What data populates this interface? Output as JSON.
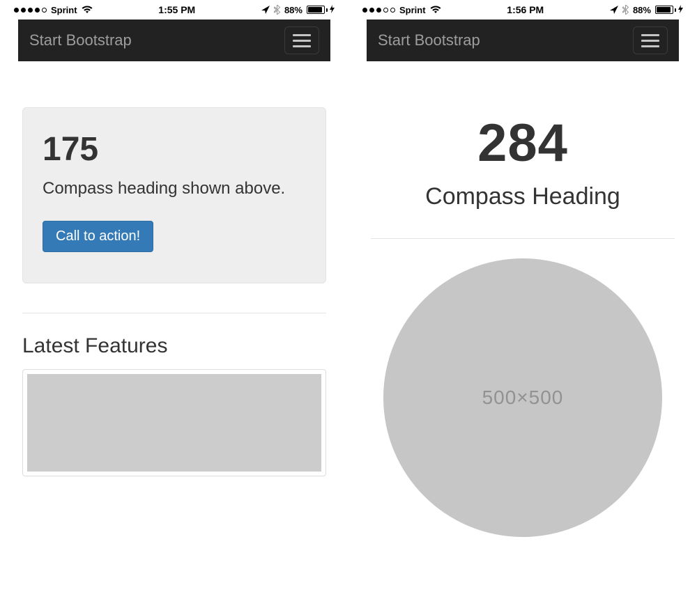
{
  "left": {
    "status": {
      "carrier": "Sprint",
      "signal_filled": 4,
      "signal_total": 5,
      "time": "1:55 PM",
      "battery_pct": "88%"
    },
    "navbar": {
      "brand": "Start Bootstrap"
    },
    "well": {
      "heading_value": "175",
      "description": "Compass heading shown above.",
      "button_label": "Call to action!"
    },
    "section_title": "Latest Features"
  },
  "right": {
    "status": {
      "carrier": "Sprint",
      "signal_filled": 3,
      "signal_total": 5,
      "time": "1:56 PM",
      "battery_pct": "88%"
    },
    "navbar": {
      "brand": "Start Bootstrap"
    },
    "hero": {
      "value": "284",
      "caption": "Compass Heading",
      "placeholder_label": "500×500"
    }
  }
}
